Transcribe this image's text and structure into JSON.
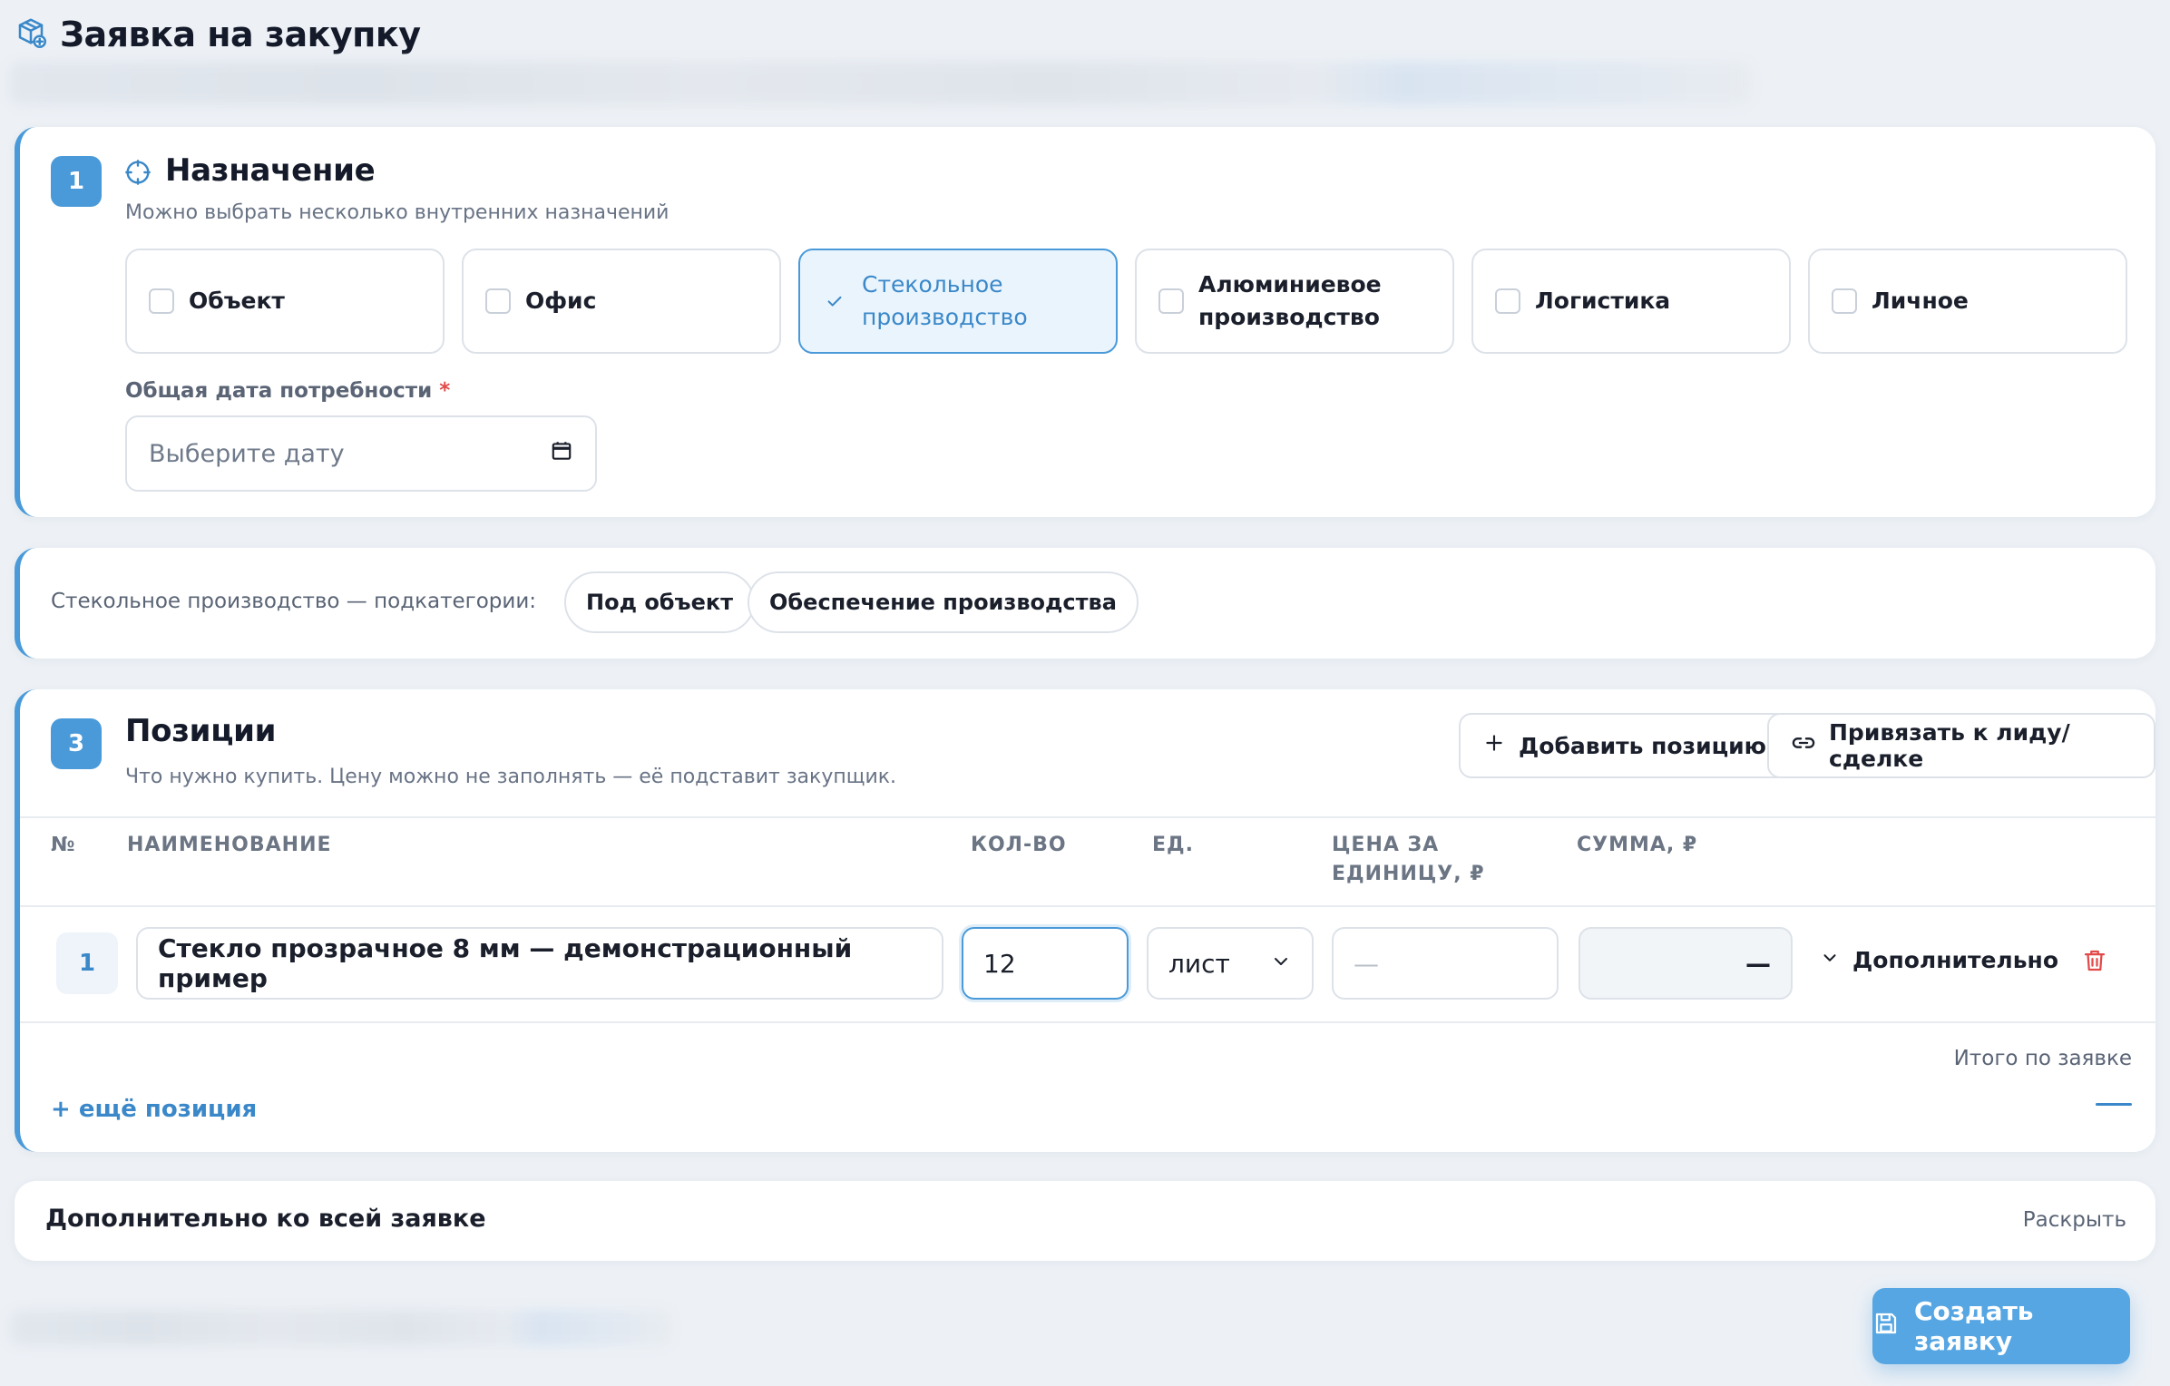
{
  "header": {
    "title": "Заявка на закупку",
    "icon": "box-plus-icon"
  },
  "purpose": {
    "step": "1",
    "title": "Назначение",
    "subtitle": "Можно выбрать несколько внутренних назначений",
    "options": [
      {
        "label": "Объект",
        "selected": false
      },
      {
        "label": "Офис",
        "selected": false
      },
      {
        "label": "Стекольное производство",
        "selected": true
      },
      {
        "label": "Алюминиевое производство",
        "selected": false
      },
      {
        "label": "Логистика",
        "selected": false
      },
      {
        "label": "Личное",
        "selected": false
      }
    ],
    "date_label": "Общая дата потребности",
    "date_required": "*",
    "date_placeholder": "Выберите дату"
  },
  "subcategories": {
    "label": "Стекольное производство — подкатегории:",
    "chips": [
      "Под объект",
      "Обеспечение производства"
    ]
  },
  "positions": {
    "step": "3",
    "title": "Позиции",
    "subtitle": "Что нужно купить. Цену можно не заполнять — её подставит закупщик.",
    "add_button": "Добавить позицию",
    "link_button": "Привязать к лиду/сделке",
    "columns": {
      "num": "№",
      "name": "Наименование",
      "qty": "Кол-во",
      "unit": "Ед.",
      "price": "Цена за единицу, ₽",
      "sum": "Сумма, ₽"
    },
    "rows": [
      {
        "num": "1",
        "name": "Стекло прозрачное 8 мм — демонстрационный пример",
        "qty": "12",
        "unit": "лист",
        "price_placeholder": "—",
        "sum": "—",
        "more_label": "Дополнительно"
      }
    ],
    "total_label": "Итого по заявке",
    "add_more": "+ ещё позиция"
  },
  "extra": {
    "title": "Дополнительно ко всей заявке",
    "action": "Раскрыть"
  },
  "submit": {
    "label": "Создать заявку"
  },
  "colors": {
    "accent": "#4a9ad9",
    "danger": "#e24a4a",
    "background": "#edf1f6"
  }
}
